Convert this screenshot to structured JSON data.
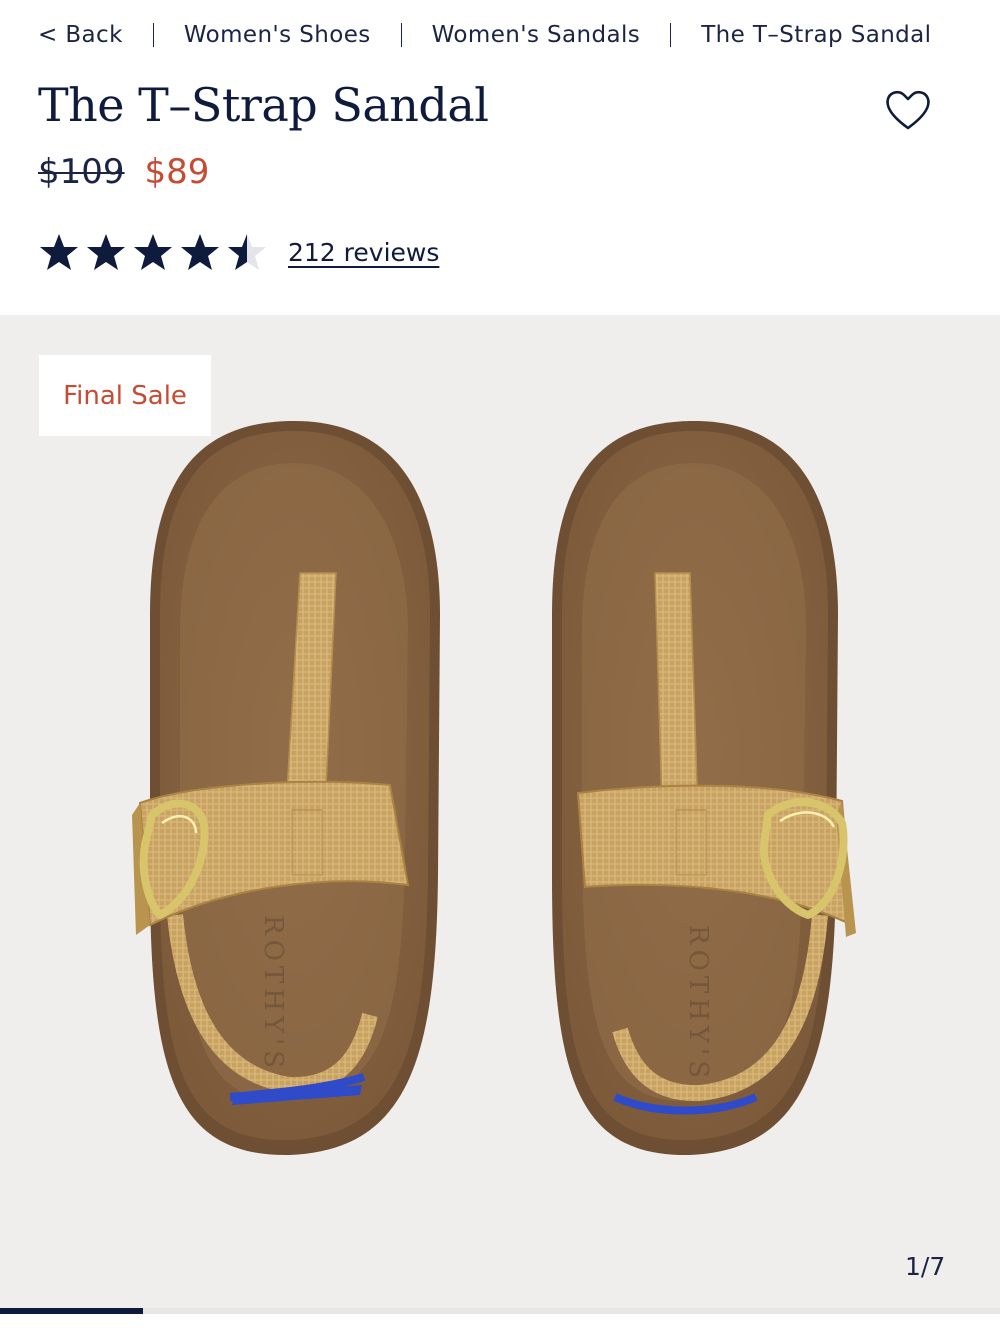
{
  "breadcrumb": {
    "back": "< Back",
    "items": [
      "Women's Shoes",
      "Women's Sandals",
      "The T–Strap Sandal"
    ]
  },
  "product": {
    "title": "The T–Strap Sandal",
    "price_original": "$109",
    "price_sale": "$89",
    "rating": 4.5,
    "rating_max": 5,
    "reviews_label": "212 reviews"
  },
  "gallery": {
    "badge": "Final Sale",
    "counter": "1/7",
    "current": 1,
    "total": 7,
    "progress_fraction": 0.1429,
    "insole_brand": "ROTHY'S"
  },
  "colors": {
    "navy": "#0f1b3d",
    "sale_red": "#c74a33",
    "gallery_bg": "#f0eeec",
    "sole_brown": "#8f6a46",
    "strap_gold": "#c9a262",
    "heel_stripe_blue": "#2f4bc9"
  },
  "icons": {
    "favorite": "heart-outline-icon",
    "star": "star-icon"
  }
}
